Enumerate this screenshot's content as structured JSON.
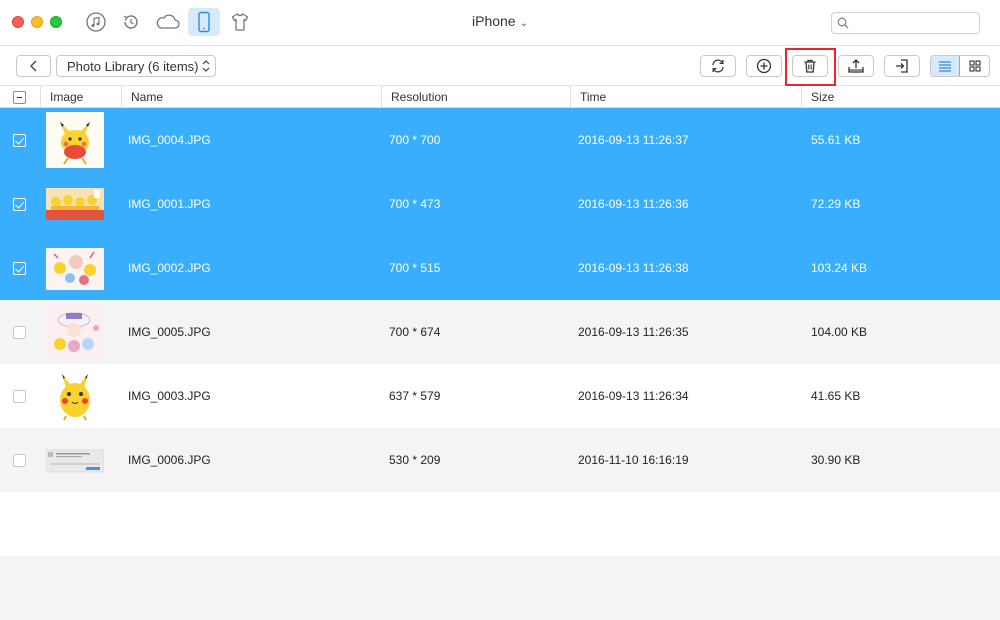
{
  "titlebar": {
    "device_name": "iPhone",
    "nav_icons": [
      "music-icon",
      "restore-icon",
      "cloud-icon",
      "phone-icon",
      "shirt-icon"
    ],
    "active_nav": "phone-icon",
    "search_placeholder": ""
  },
  "toolbar": {
    "album_label": "Photo Library (6 items)",
    "actions": [
      "refresh-icon",
      "add-icon",
      "delete-icon",
      "export-to-computer-icon",
      "send-to-device-icon"
    ],
    "highlighted_action": "delete-icon",
    "highlight_color": "#e8262b",
    "view_modes": [
      "list-view-icon",
      "grid-view-icon"
    ],
    "active_view": "list-view-icon"
  },
  "table": {
    "columns": [
      "Image",
      "Name",
      "Resolution",
      "Time",
      "Size"
    ],
    "rows": [
      {
        "name": "IMG_0004.JPG",
        "resolution": "700 * 700",
        "time": "2016-09-13 11:26:37",
        "size": "55.61 KB",
        "selected": true
      },
      {
        "name": "IMG_0001.JPG",
        "resolution": "700 * 473",
        "time": "2016-09-13 11:26:36",
        "size": "72.29 KB",
        "selected": true
      },
      {
        "name": "IMG_0002.JPG",
        "resolution": "700 * 515",
        "time": "2016-09-13 11:26:38",
        "size": "103.24 KB",
        "selected": true
      },
      {
        "name": "IMG_0005.JPG",
        "resolution": "700 * 674",
        "time": "2016-09-13 11:26:35",
        "size": "104.00 KB",
        "selected": false
      },
      {
        "name": "IMG_0003.JPG",
        "resolution": "637 * 579",
        "time": "2016-09-13 11:26:34",
        "size": "41.65 KB",
        "selected": false
      },
      {
        "name": "IMG_0006.JPG",
        "resolution": "530 * 209",
        "time": "2016-11-10 16:16:19",
        "size": "30.90 KB",
        "selected": false
      }
    ]
  },
  "colors": {
    "selection": "#38aefc",
    "active_button": "#d7e9fb",
    "accent": "#2a8ce0"
  }
}
